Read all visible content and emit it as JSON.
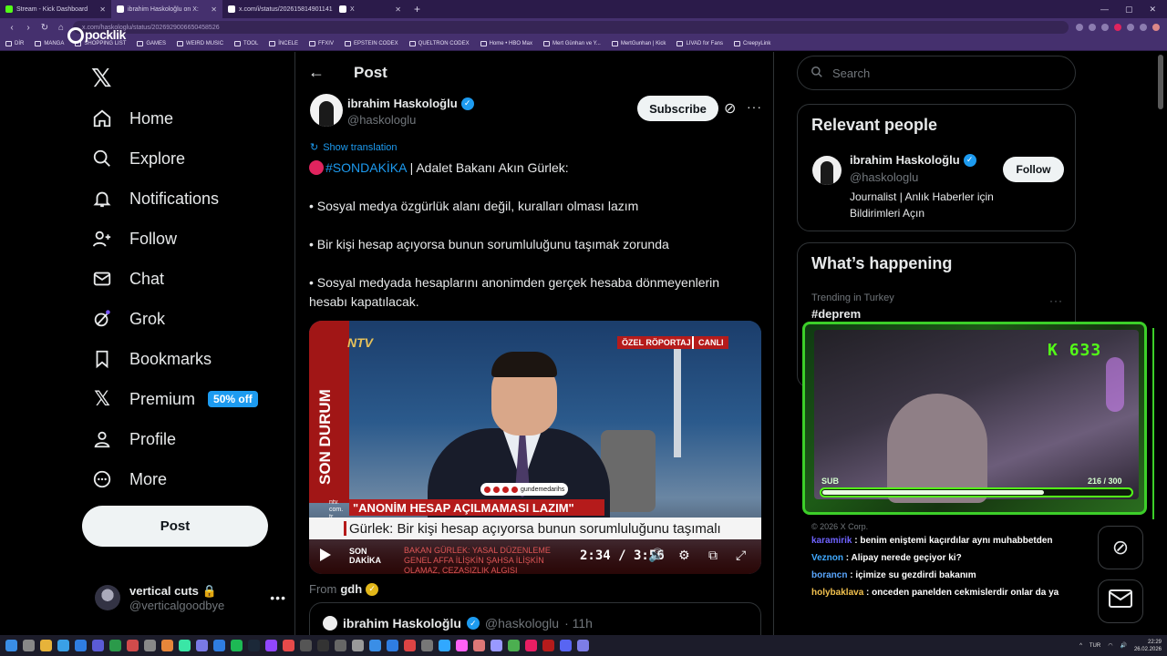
{
  "browser": {
    "tabs": [
      {
        "label": "Stream - Kick Dashboard",
        "fav": "#53fc18",
        "active": false
      },
      {
        "label": "ibrahim Haskoloğlu on X: ",
        "fav": "#ffffff",
        "active": true
      },
      {
        "label": "x.com/i/status/202615814901141",
        "fav": "#ffffff",
        "active": false
      },
      {
        "label": "X",
        "fav": "#ffffff",
        "active": false
      }
    ],
    "url": "x.com/haskologlu/status/2026929006650458526",
    "bookmarks": [
      "DİR",
      "MANGA",
      "SHOPPING LIST",
      "GAMES",
      "WEIRD MUSIC",
      "TOOL",
      "İNCELE",
      "FFXIV",
      "EPSTEIN CODEX",
      "QUELTRON CODEX",
      "Home • HBO Max",
      "Mert Günhan ve Y...",
      "MertGunhan | Kick",
      "LIVAD for Fans",
      "CreepyLink"
    ],
    "overlay_logo": "pocklik"
  },
  "nav": {
    "logo": "𝕏",
    "items": [
      {
        "label": "Home",
        "icon": "home-icon"
      },
      {
        "label": "Explore",
        "icon": "search-icon"
      },
      {
        "label": "Notifications",
        "icon": "bell-icon"
      },
      {
        "label": "Follow",
        "icon": "follow-icon"
      },
      {
        "label": "Chat",
        "icon": "mail-icon"
      },
      {
        "label": "Grok",
        "icon": "grok-icon"
      },
      {
        "label": "Bookmarks",
        "icon": "bookmark-icon"
      },
      {
        "label": "Premium",
        "icon": "x-icon"
      },
      {
        "label": "Profile",
        "icon": "profile-icon"
      },
      {
        "label": "More",
        "icon": "more-icon"
      }
    ],
    "premium_badge": "50% off",
    "post_label": "Post",
    "account": {
      "name": "vertical cuts",
      "handle": "@verticalgoodbye"
    }
  },
  "post": {
    "header": "Post",
    "author": {
      "name": "ibrahim Haskoloğlu",
      "handle": "@haskologlu"
    },
    "subscribe_label": "Subscribe",
    "show_translation": "Show translation",
    "hashtag": "#SONDAKİKA",
    "line1_rest": " | Adalet Bakanı Akın Gürlek:",
    "bullets": [
      "• Sosyal medya özgürlük alanı değil, kuralları olması lazım",
      "• Bir kişi hesap açıyorsa bunun sorumluluğunu taşımak zorunda",
      "• Sosyal medyada hesaplarını anonimden gerçek hesaba dönmeyenlerin hesabı kapatılacak."
    ],
    "video": {
      "channel": "NTV",
      "sidebar": "SON DURUM",
      "tag_ozel": "ÖZEL RÖPORTAJ",
      "tag_canli": "CANLI",
      "social": "gundemedarihs",
      "url_small": "ntv. com. tr",
      "banner": "\"ANONİM HESAP AÇILMAMASI LAZIM\"",
      "subtitle": "Gürlek: Bir kişi hesap açıyorsa bunun sorumluluğunu taşımalı",
      "ticker_left": "SON DAKİKA",
      "ticker_right": "BAKAN GÜRLEK: YASAL DÜZENLEME  GENEL AFFA İLİŞKİN  ŞAHSA İLİŞKİN OLAMAZ, CEZASIZLIK ALGISI",
      "time": "2:34 / 3:56"
    },
    "from_label": "From",
    "from_name": "gdh",
    "quote": {
      "name": "ibrahim Haskoloğlu",
      "handle": "@haskologlu",
      "age": "· 11h"
    }
  },
  "right": {
    "search_placeholder": "Search",
    "relevant_title": "Relevant people",
    "person": {
      "name": "ibrahim Haskoloğlu",
      "handle": "@haskologlu",
      "follow": "Follow",
      "bio": "Journalist | Anlık Haberler için Bildirimleri Açın"
    },
    "happening_title": "What’s happening",
    "trend_meta": "Trending in Turkey",
    "trend_tag": "#deprem",
    "copyright": "© 2026 X Corp."
  },
  "stream": {
    "viewer_count": "633",
    "sub_label": "SUB",
    "sub_count": "216 / 300",
    "sub_progress": 0.72,
    "chat": [
      {
        "user": "karamirik",
        "color": "#6f63ff",
        "msg": " : benim eniştemi kaçırdılar aynı muhabbetden"
      },
      {
        "user": "Veznon",
        "color": "#40a9ff",
        "msg": " : Alipay nerede geçiyor ki?"
      },
      {
        "user": "borancn",
        "color": "#5aa7ff",
        "msg": " : içimize su gezdirdi bakanım"
      },
      {
        "user": "holybaklava",
        "color": "#f2c14e",
        "msg": " : onceden panelden cekmislerdir onlar da ya"
      }
    ]
  },
  "taskbar": {
    "lang": "TUR",
    "time": "22:29",
    "date": "26.02.2026"
  }
}
